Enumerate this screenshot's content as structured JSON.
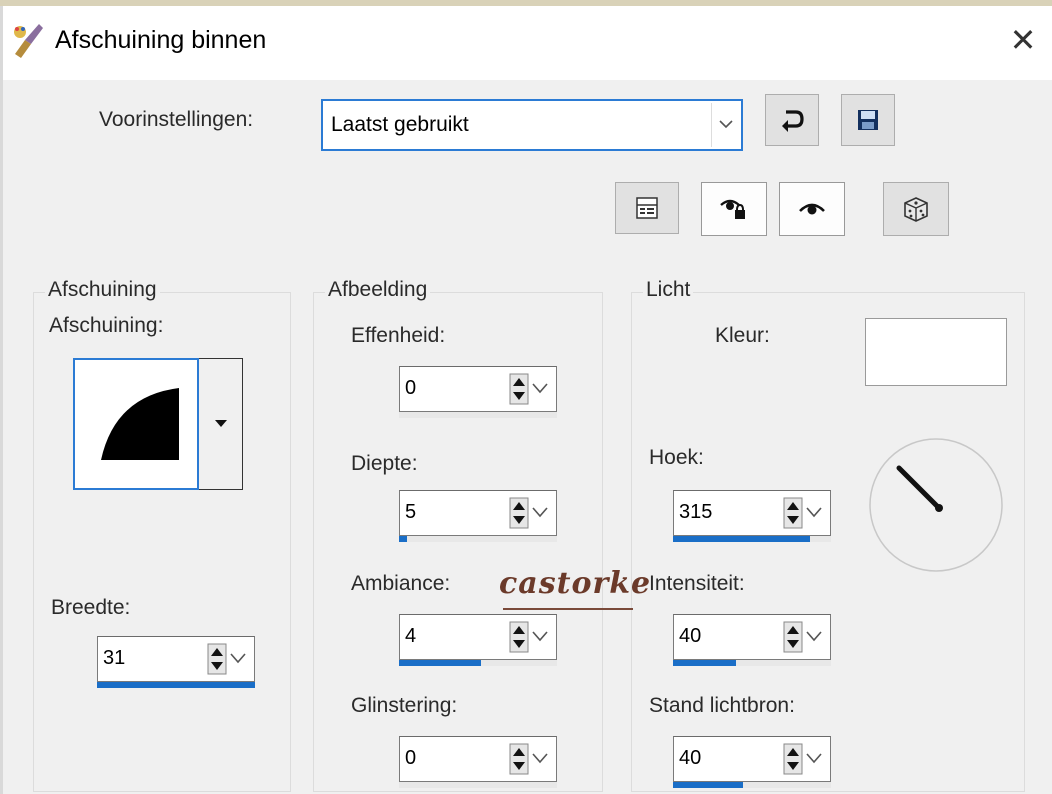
{
  "window": {
    "title": "Afschuining binnen"
  },
  "presets": {
    "label": "Voorinstellingen:",
    "selected": "Laatst gebruikt"
  },
  "toolbar": {
    "reset_icon": "reset-arrow-icon",
    "save_icon": "save-disk-icon",
    "dialog_icon": "dialog-layout-icon",
    "lock_preview_icon": "lock-eye-icon",
    "preview_icon": "eye-icon",
    "random_icon": "dice-icon"
  },
  "groups": {
    "bevel": {
      "title": "Afschuining",
      "bevel_label": "Afschuining:",
      "width_label": "Breedte:",
      "width_value": "31",
      "width_fill": 1.0
    },
    "image": {
      "title": "Afbeelding",
      "smoothness_label": "Effenheid:",
      "smoothness_value": "0",
      "smoothness_fill": 0,
      "depth_label": "Diepte:",
      "depth_value": "5",
      "depth_fill": 0.05,
      "ambience_label": "Ambiance:",
      "ambience_value": "4",
      "ambience_fill": 0.52,
      "shininess_label": "Glinstering:",
      "shininess_value": "0",
      "shininess_fill": 0
    },
    "light": {
      "title": "Licht",
      "color_label": "Kleur:",
      "color_value": "#ffffff",
      "angle_label": "Hoek:",
      "angle_value": "315",
      "angle_fill": 0.87,
      "intensity_label": "Intensiteit:",
      "intensity_value": "40",
      "intensity_fill": 0.4,
      "elevation_label": "Stand lichtbron:",
      "elevation_value": "40",
      "elevation_fill": 0.44
    }
  },
  "watermark": "castorke",
  "colors": {
    "accent": "#1a6ec7",
    "focus_border": "#2b7bd4"
  }
}
